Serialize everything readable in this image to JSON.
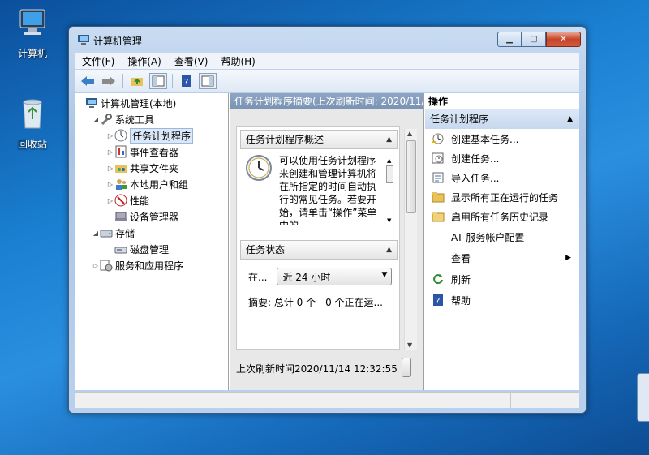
{
  "desktop": {
    "icons": [
      {
        "label": "计算机",
        "icon": "computer-icon"
      },
      {
        "label": "回收站",
        "icon": "recycle-bin-icon"
      }
    ]
  },
  "window": {
    "title": "计算机管理",
    "menu": [
      "文件(F)",
      "操作(A)",
      "查看(V)",
      "帮助(H)"
    ]
  },
  "tree": {
    "items": [
      {
        "label": "计算机管理(本地)",
        "level": 0,
        "arrow": "",
        "icon": "computer-management-icon"
      },
      {
        "label": "系统工具",
        "level": 1,
        "arrow": "◢",
        "icon": "system-tools-icon"
      },
      {
        "label": "任务计划程序",
        "level": 2,
        "arrow": "▷",
        "icon": "task-scheduler-icon",
        "selected": true
      },
      {
        "label": "事件查看器",
        "level": 2,
        "arrow": "▷",
        "icon": "event-viewer-icon"
      },
      {
        "label": "共享文件夹",
        "level": 2,
        "arrow": "▷",
        "icon": "shared-folders-icon"
      },
      {
        "label": "本地用户和组",
        "level": 2,
        "arrow": "▷",
        "icon": "local-users-icon"
      },
      {
        "label": "性能",
        "level": 2,
        "arrow": "▷",
        "icon": "performance-icon"
      },
      {
        "label": "设备管理器",
        "level": 2,
        "arrow": "",
        "icon": "device-manager-icon"
      },
      {
        "label": "存储",
        "level": 1,
        "arrow": "◢",
        "icon": "storage-icon"
      },
      {
        "label": "磁盘管理",
        "level": 2,
        "arrow": "",
        "icon": "disk-management-icon"
      },
      {
        "label": "服务和应用程序",
        "level": 1,
        "arrow": "▷",
        "icon": "services-apps-icon"
      }
    ]
  },
  "middle": {
    "header": "任务计划程序摘要(上次刷新时间: 2020/11/",
    "overview": {
      "title": "任务计划程序概述",
      "text": "可以使用任务计划程序来创建和管理计算机将在所指定的时间自动执行的常见任务。若要开始，请单击“操作”菜单中的"
    },
    "status": {
      "title": "任务状态",
      "filter_label": "在...",
      "filter_value": "近 24 小时",
      "summary": "摘要: 总计 0 个 - 0 个正在运..."
    },
    "last_refresh": "上次刷新时间2020/11/14 12:32:55"
  },
  "actions": {
    "header": "操作",
    "group": "任务计划程序",
    "items": [
      {
        "label": "创建基本任务...",
        "icon": "create-basic-task-icon"
      },
      {
        "label": "创建任务...",
        "icon": "create-task-icon"
      },
      {
        "label": "导入任务...",
        "icon": "import-task-icon"
      },
      {
        "label": "显示所有正在运行的任务",
        "icon": "running-tasks-icon"
      },
      {
        "label": "启用所有任务历史记录",
        "icon": "task-history-icon"
      },
      {
        "label": "AT 服务帐户配置",
        "icon": ""
      },
      {
        "label": "查看",
        "icon": "",
        "submenu": true
      },
      {
        "label": "刷新",
        "icon": "refresh-icon"
      },
      {
        "label": "帮助",
        "icon": "help-icon"
      }
    ]
  }
}
